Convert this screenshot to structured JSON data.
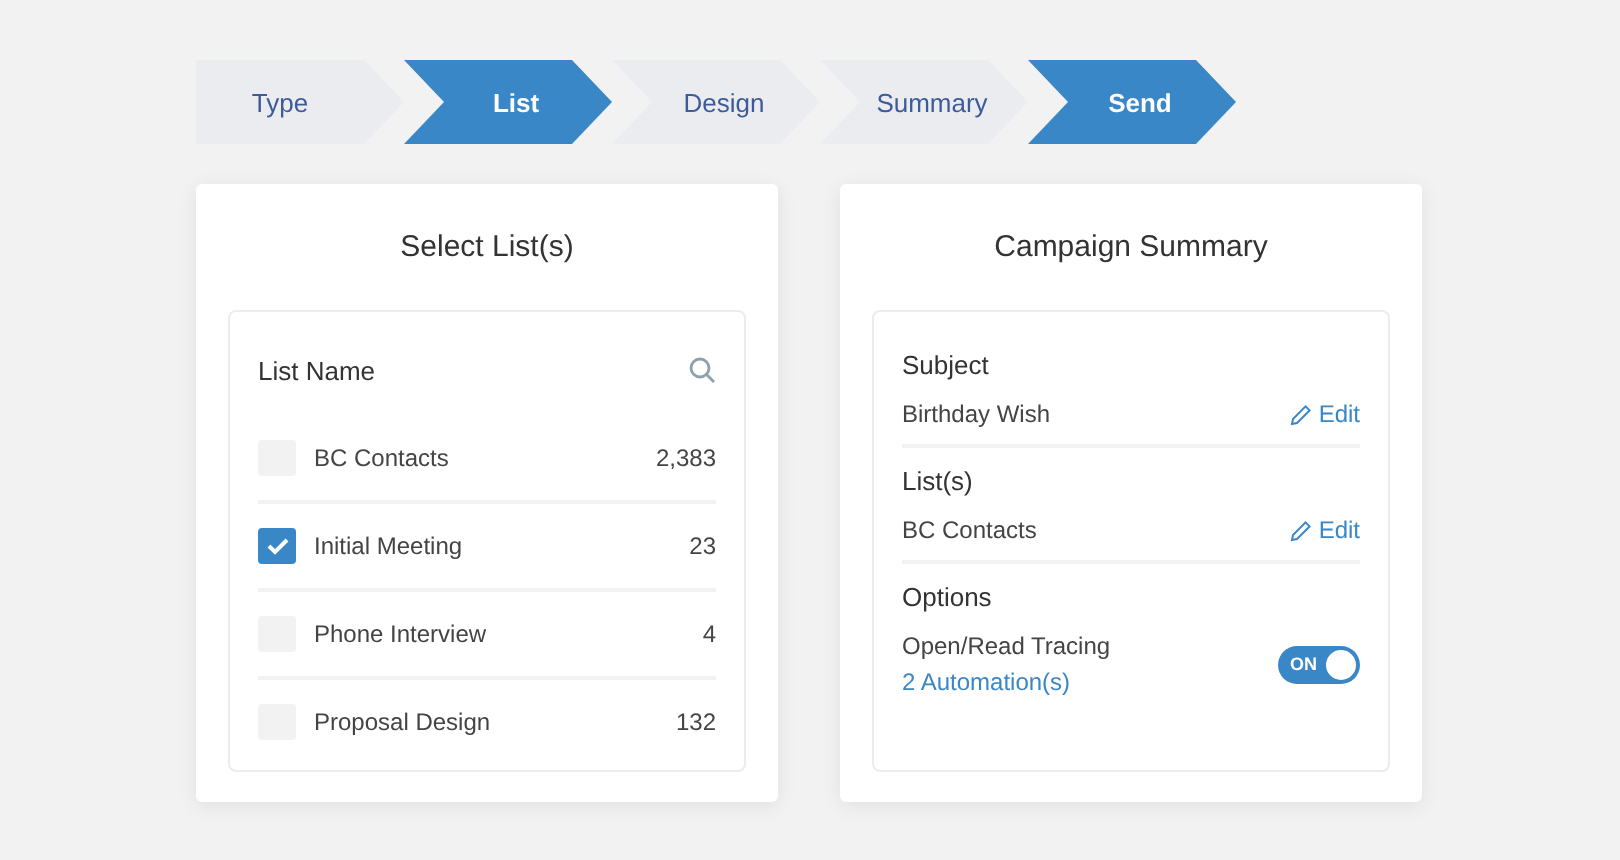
{
  "steps": [
    {
      "label": "Type",
      "selected": false
    },
    {
      "label": "List",
      "selected": true
    },
    {
      "label": "Design",
      "selected": false
    },
    {
      "label": "Summary",
      "selected": false
    },
    {
      "label": "Send",
      "selected": true
    }
  ],
  "list_card": {
    "title": "Select List(s)",
    "header": "List Name",
    "rows": [
      {
        "name": "BC Contacts",
        "count": "2,383",
        "checked": false
      },
      {
        "name": "Initial Meeting",
        "count": "23",
        "checked": true
      },
      {
        "name": "Phone Interview",
        "count": "4",
        "checked": false
      },
      {
        "name": "Proposal Design",
        "count": "132",
        "checked": false
      }
    ]
  },
  "summary_card": {
    "title": "Campaign Summary",
    "sections": [
      {
        "kind": "edit",
        "heading": "Subject",
        "value": "Birthday Wish",
        "action": "Edit"
      },
      {
        "kind": "edit",
        "heading": "List(s)",
        "value": "BC Contacts",
        "action": "Edit"
      },
      {
        "kind": "toggle",
        "heading": "Options",
        "value": "Open/Read Tracing",
        "link": "2 Automation(s)",
        "toggle_label": "ON",
        "on": true
      }
    ]
  }
}
